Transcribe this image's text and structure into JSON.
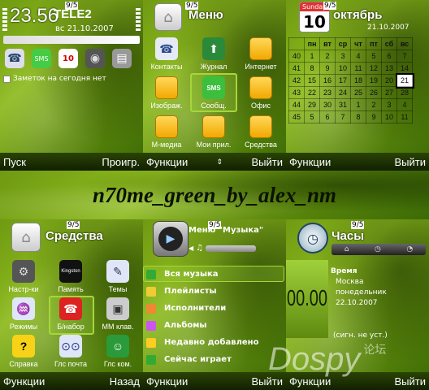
{
  "banner": "n70me_green_by_alex_nm",
  "watermark": {
    "main": "Dospy",
    "sub": "论坛"
  },
  "signal": "9/5",
  "colors": {
    "accent": "#a7d63a",
    "theme_green": "#7ba516"
  },
  "standby": {
    "time": "23.56",
    "operator": "TELE2",
    "date": "вс 21.10.2007",
    "notes": "Заметок на сегодня нет",
    "shortcuts": [
      "contacts-icon",
      "messaging-icon",
      "calendar-icon",
      "camera-icon",
      "printer-icon"
    ],
    "left_soft": "Пуск",
    "right_soft": "Проигр."
  },
  "menu": {
    "title": "Меню",
    "items": [
      "Контакты",
      "Журнал",
      "Интернет",
      "Изображ.",
      "Сообщ.",
      "Офис",
      "М-медиа",
      "Мои прил.",
      "Средства"
    ],
    "left_soft": "Функции",
    "right_soft": "Выйти",
    "sms_label": "SMS"
  },
  "calendar": {
    "day_name": "Sunday",
    "day_num": "10",
    "month": "октябрь",
    "date": "21.10.2007",
    "headers": [
      "",
      "пн",
      "вт",
      "ср",
      "чт",
      "пт",
      "сб",
      "вс"
    ],
    "weeks": [
      [
        "40",
        "1",
        "2",
        "3",
        "4",
        "5",
        "6",
        "7"
      ],
      [
        "41",
        "8",
        "9",
        "10",
        "11",
        "12",
        "13",
        "14"
      ],
      [
        "42",
        "15",
        "16",
        "17",
        "18",
        "19",
        "20",
        "21"
      ],
      [
        "43",
        "22",
        "23",
        "24",
        "25",
        "26",
        "27",
        "28"
      ],
      [
        "44",
        "29",
        "30",
        "31",
        "1",
        "2",
        "3",
        "4"
      ],
      [
        "45",
        "5",
        "6",
        "7",
        "8",
        "9",
        "10",
        "11"
      ]
    ],
    "left_soft": "Функции",
    "right_soft": "Выйти"
  },
  "tools": {
    "title": "Средства",
    "items": [
      "Настр-ки",
      "Память",
      "Темы",
      "Режимы",
      "Б/набор",
      "ММ клав.",
      "Справка",
      "Глс почта",
      "Глс ком."
    ],
    "memory_label": "Kingston",
    "left_soft": "Функции",
    "right_soft": "Назад"
  },
  "music": {
    "title": "Меню \"Музыка\"",
    "items": [
      "Вся музыка",
      "Плейлисты",
      "Исполнители",
      "Альбомы",
      "Недавно добавлено",
      "Сейчас играет"
    ],
    "left_soft": "Функции",
    "right_soft": "Выйти"
  },
  "clock": {
    "title": "Часы",
    "digital": "00.00",
    "label": "Время",
    "city": "Москва",
    "weekday": "понедельник",
    "date": "22.10.2007",
    "alarm": "(сигн. не уст.)",
    "left_soft": "Функции",
    "right_soft": "Выйти"
  }
}
